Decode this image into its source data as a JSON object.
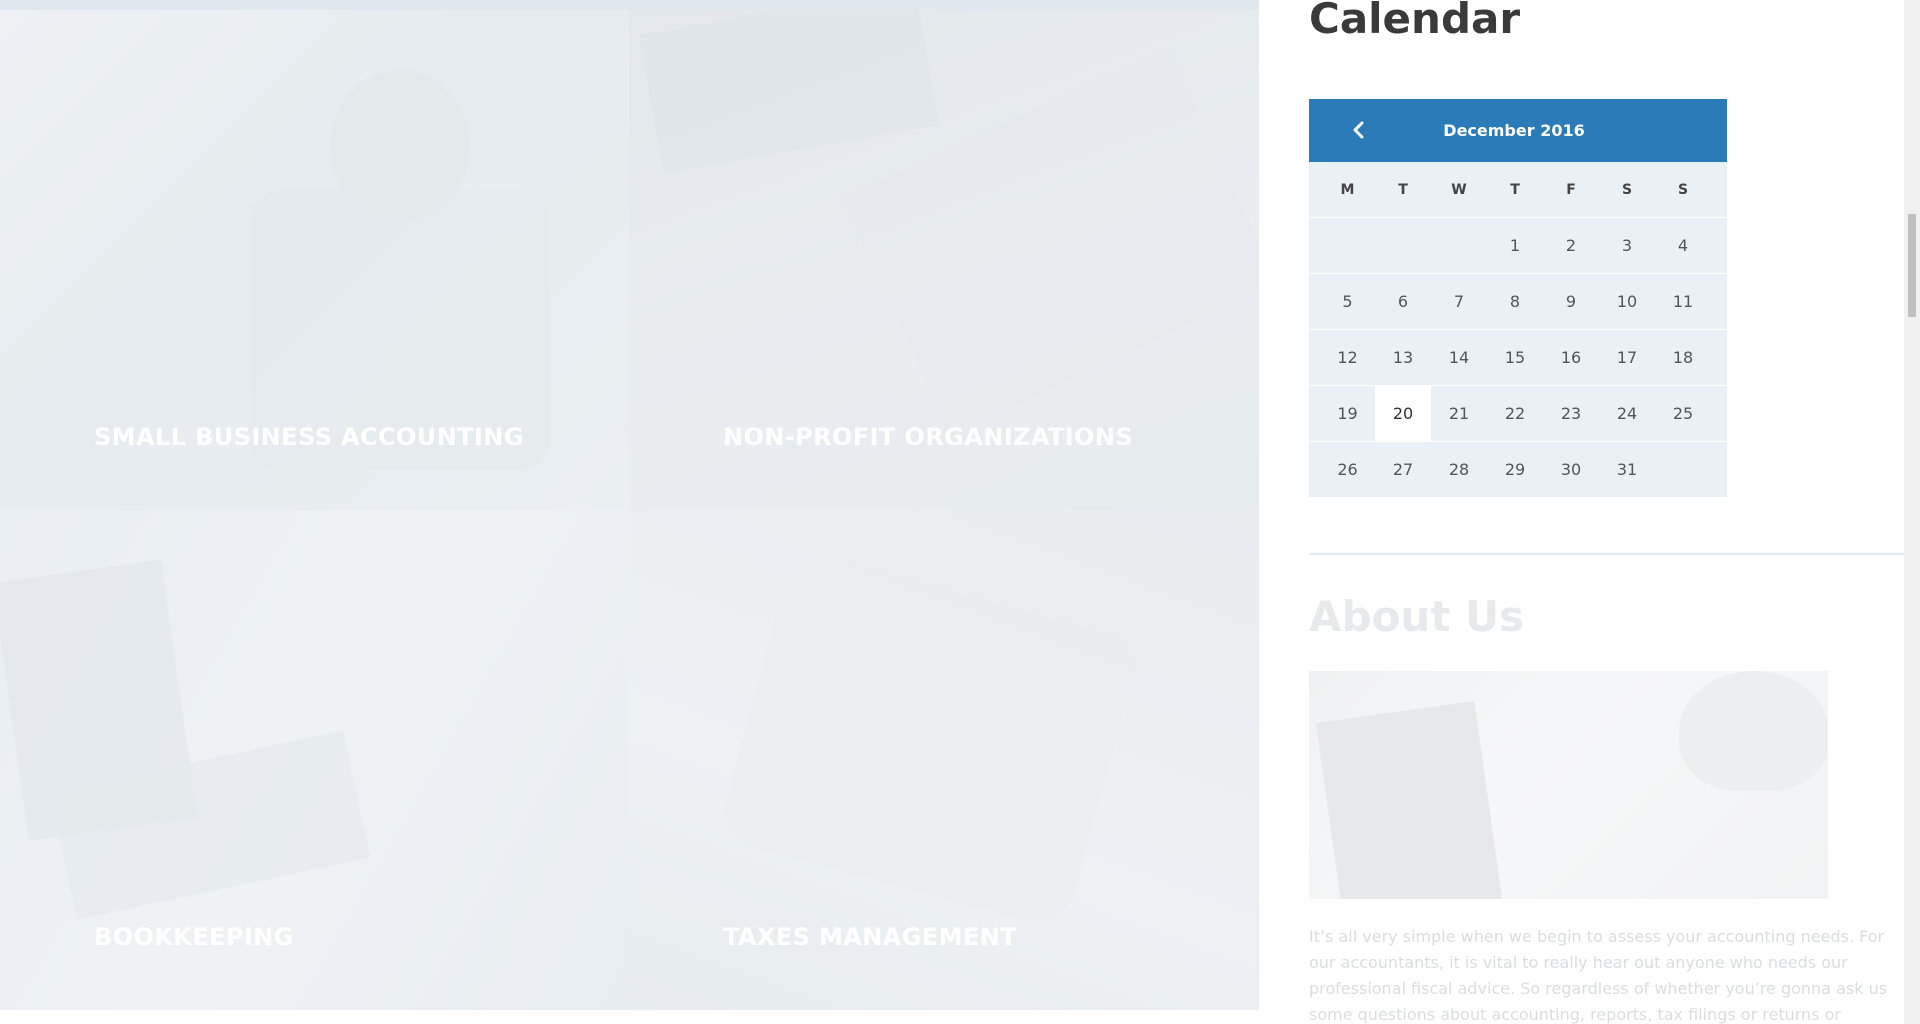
{
  "services": {
    "tiles": [
      {
        "label": "SMALL BUSINESS ACCOUNTING"
      },
      {
        "label": "NON-PROFIT ORGANIZATIONS"
      },
      {
        "label": "BOOKKEEPING"
      },
      {
        "label": "TAXES MANAGEMENT"
      }
    ]
  },
  "calendar": {
    "title": "Calendar",
    "month": "December 2016",
    "prev_icon": "chevron-left-icon",
    "weekdays": [
      "M",
      "T",
      "W",
      "T",
      "F",
      "S",
      "S"
    ],
    "weeks": [
      [
        "",
        "",
        "",
        "1",
        "2",
        "3",
        "4"
      ],
      [
        "5",
        "6",
        "7",
        "8",
        "9",
        "10",
        "11"
      ],
      [
        "12",
        "13",
        "14",
        "15",
        "16",
        "17",
        "18"
      ],
      [
        "19",
        "20",
        "21",
        "22",
        "23",
        "24",
        "25"
      ],
      [
        "26",
        "27",
        "28",
        "29",
        "30",
        "31",
        ""
      ]
    ],
    "today": "20",
    "header_color": "#2b7bb9"
  },
  "about": {
    "title": "About Us",
    "text": "It’s all very simple when we begin to assess your accounting needs. For our accountants, it is vital to really hear out anyone who needs our professional fiscal advice. So regardless of whether you’re gonna ask us some questions about accounting, reports, tax filings or returns or"
  }
}
